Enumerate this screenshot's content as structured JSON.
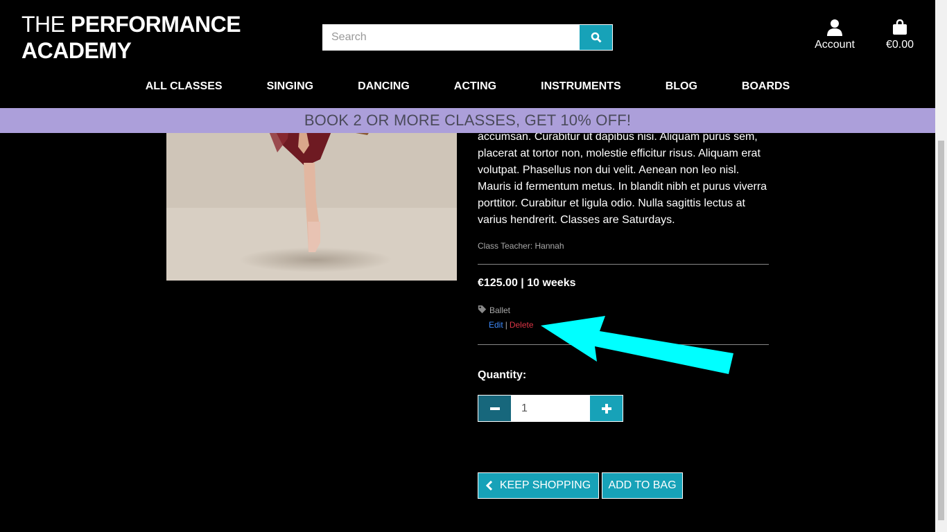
{
  "header": {
    "logo_part1": "THE ",
    "logo_part2": "PERFORMANCE",
    "logo_line2": "ACADEMY",
    "search_placeholder": "Search",
    "account_label": "Account",
    "bag_total": "€0.00"
  },
  "nav": {
    "items": [
      "ALL CLASSES",
      "SINGING",
      "DANCING",
      "ACTING",
      "INSTRUMENTS",
      "BLOG",
      "BOARDS"
    ]
  },
  "banner": {
    "text": "BOOK 2 OR MORE CLASSES, GET 10% OFF!"
  },
  "product": {
    "description": "accumsan. Curabitur ut dapibus nisi. Aliquam purus sem, placerat at tortor non, molestie efficitur risus. Aliquam erat volutpat. Phasellus non dui velit. Aenean non leo nisl. Mauris id fermentum metus. In blandit nibh et purus viverra porttitor. Curabitur et ligula odio. Nulla sagittis lectus at varius hendrerit. Classes are Saturdays.",
    "teacher": "Class Teacher: Hannah",
    "price": "€125.00 | 10 weeks",
    "tag": "Ballet",
    "edit_label": "Edit",
    "separator": "|",
    "delete_label": "Delete",
    "quantity_label": "Quantity:",
    "quantity_value": "1",
    "keep_shopping_label": "KEEP SHOPPING",
    "add_to_bag_label": "ADD TO BAG"
  },
  "colors": {
    "accent": "#17a2b8",
    "banner": "#ac9fda",
    "annotation_arrow": "#00ffff"
  }
}
